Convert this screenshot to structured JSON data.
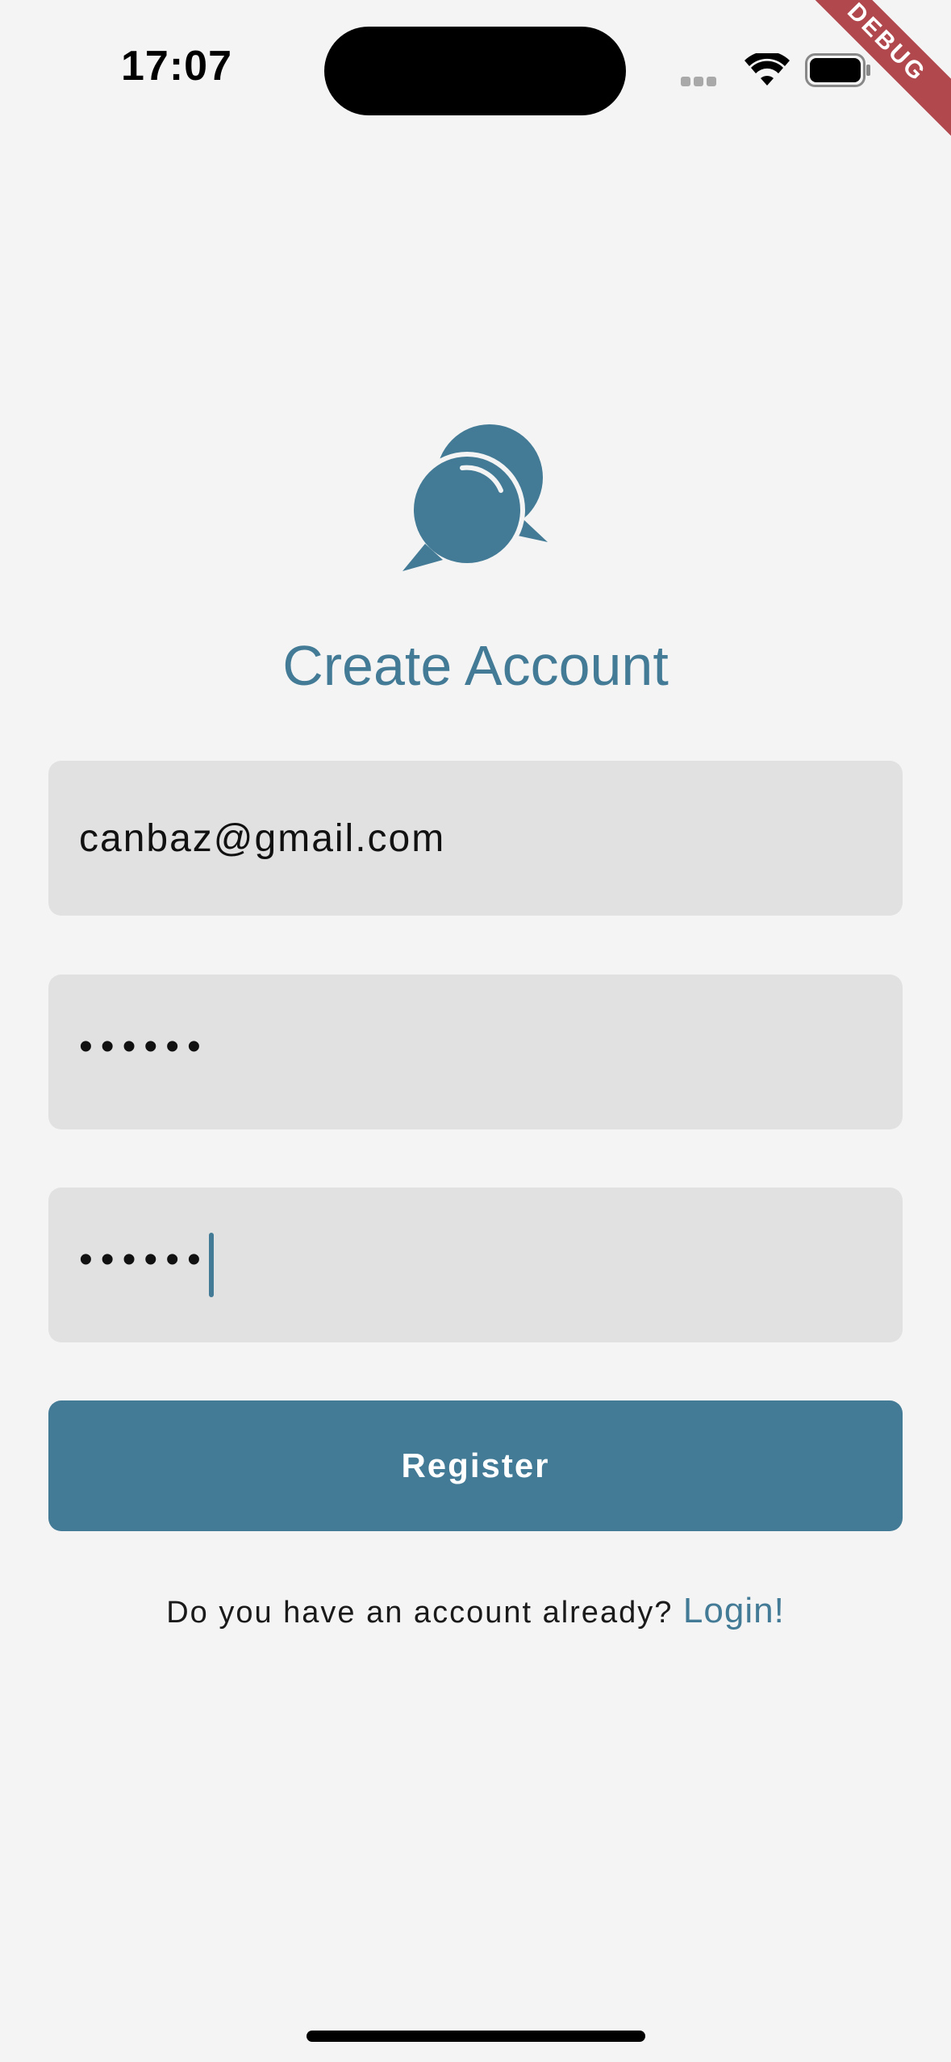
{
  "status_bar": {
    "time": "17:07",
    "icons": [
      "signal-icon",
      "wifi-icon",
      "battery-icon"
    ]
  },
  "debug_banner": "DEBUG",
  "logo": {
    "icon": "chat-bubbles-icon",
    "color": "#437b96"
  },
  "page_title": "Create Account",
  "form": {
    "email": {
      "value": "canbaz@gmail.com"
    },
    "password": {
      "value": "••••••"
    },
    "confirm_password": {
      "value": "••••••"
    }
  },
  "register_button": {
    "label": "Register"
  },
  "login_prompt": {
    "text": "Do you have an account already?",
    "link_label": "Login!"
  },
  "colors": {
    "accent": "#437b96",
    "background": "#f4f4f4",
    "field": "#e1e1e1",
    "debug": "#b0484d"
  }
}
